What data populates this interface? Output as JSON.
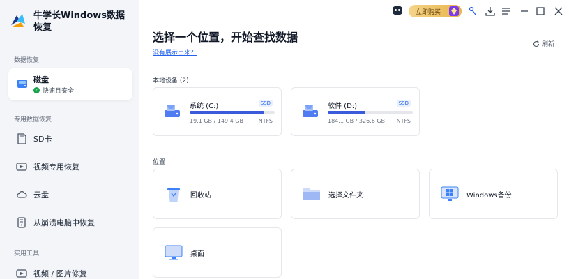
{
  "app": {
    "title": "牛学长Windows数据恢复"
  },
  "titlebar": {
    "buy_label": "立即购买",
    "icons": [
      "robot-icon",
      "pin-icon",
      "download-icon",
      "menu-icon",
      "minimize-icon",
      "maximize-icon",
      "close-icon"
    ]
  },
  "sidebar": {
    "section_recovery": "数据恢复",
    "active_item": {
      "label": "磁盘",
      "sub": "快速且安全"
    },
    "section_special": "专用数据恢复",
    "items": [
      {
        "label": "SD卡",
        "icon": "sd-card-icon"
      },
      {
        "label": "视频专用恢复",
        "icon": "video-icon"
      },
      {
        "label": "云盘",
        "icon": "cloud-icon"
      },
      {
        "label": "从崩溃电脑中恢复",
        "icon": "crashed-pc-icon"
      }
    ],
    "section_tools": "实用工具",
    "tools": [
      {
        "label": "视频 / 图片修复",
        "icon": "repair-icon"
      }
    ]
  },
  "main": {
    "title": "选择一个位置，开始查找数据",
    "missing_link": "没有展示出来？",
    "refresh_label": "刷新",
    "local_devices_label": "本地设备 (2)",
    "drives": [
      {
        "name": "系统 (C:)",
        "tag": "SSD",
        "size": "19.1 GB / 149.4 GB",
        "fs": "NTFS",
        "usage": 0.87
      },
      {
        "name": "软件 (D:)",
        "tag": "SSD",
        "size": "184.1 GB / 326.6 GB",
        "fs": "NTFS",
        "usage": 0.44
      }
    ],
    "locations_label": "位置",
    "locations": [
      {
        "name": "回收站",
        "icon": "recycle-bin-icon"
      },
      {
        "name": "选择文件夹",
        "icon": "folder-icon"
      },
      {
        "name": "Windows备份",
        "icon": "windows-backup-icon"
      },
      {
        "name": "桌面",
        "icon": "desktop-icon"
      }
    ]
  },
  "colors": {
    "accent": "#3b5bdb",
    "sidebar_bg": "#f3f5f9",
    "buy_gold": "#e8b44a",
    "safe_green": "#16a34a"
  }
}
